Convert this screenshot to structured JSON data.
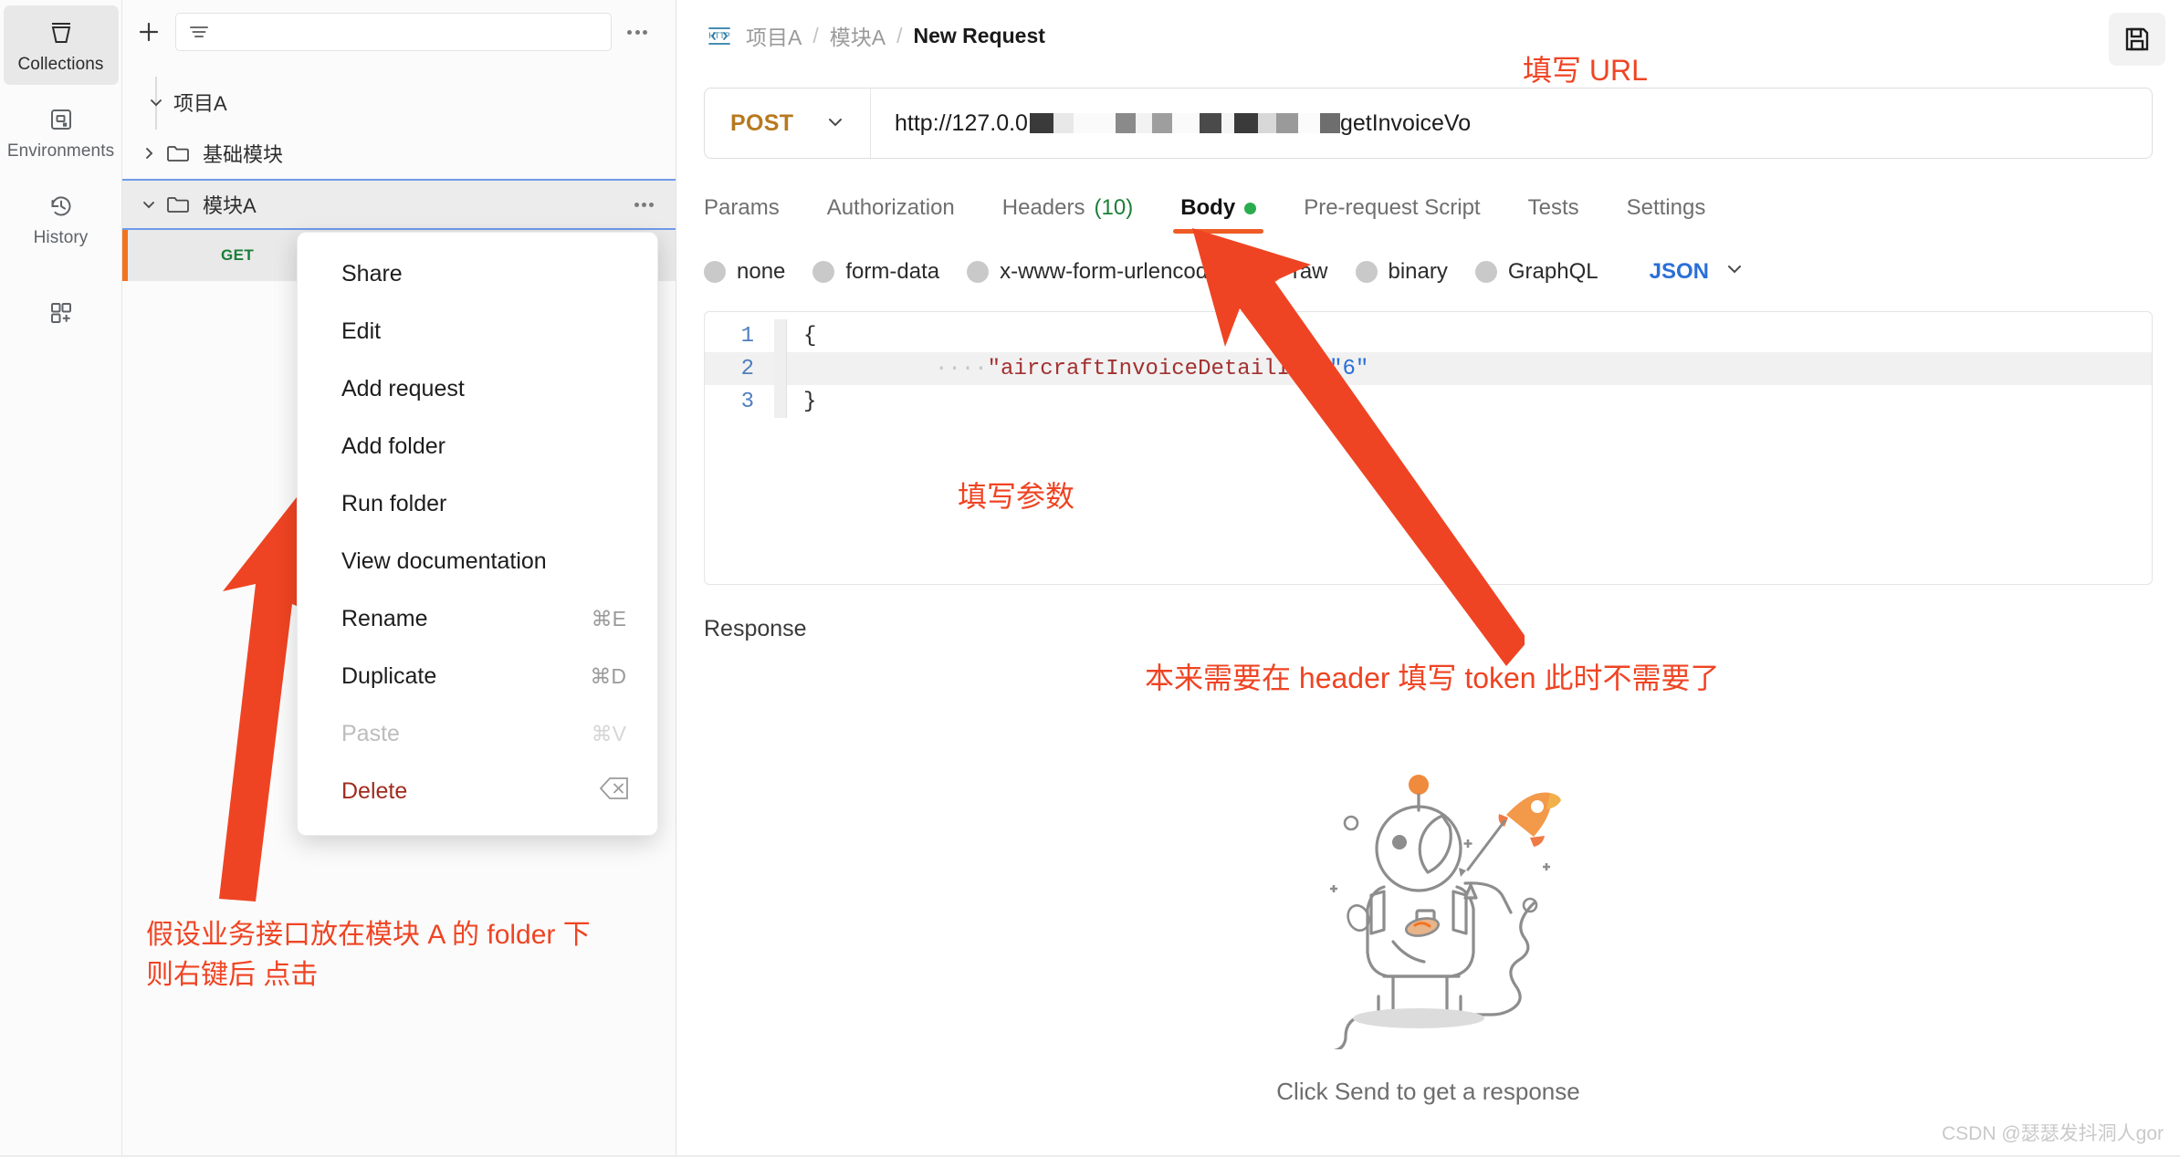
{
  "rail": {
    "items": [
      {
        "label": "Collections",
        "icon": "collections-icon",
        "active": true
      },
      {
        "label": "Environments",
        "icon": "environments-icon",
        "active": false
      },
      {
        "label": "History",
        "icon": "history-icon",
        "active": false
      },
      {
        "label": "",
        "icon": "apps-grid-icon",
        "active": false
      }
    ]
  },
  "sidebar": {
    "new_button": "+",
    "filter_placeholder": "",
    "more_options": "•••",
    "tree": [
      {
        "label": "项目A",
        "level": 1,
        "expanded": true,
        "type": "collection"
      },
      {
        "label": "基础模块",
        "level": 2,
        "expanded": false,
        "type": "folder"
      },
      {
        "label": "模块A",
        "level": 2,
        "expanded": true,
        "type": "folder",
        "selected": true
      },
      {
        "label": "",
        "level": 3,
        "method": "GET",
        "type": "request"
      }
    ]
  },
  "context_menu": {
    "items": [
      {
        "label": "Share",
        "shortcut": "",
        "disabled": false,
        "danger": false
      },
      {
        "label": "Edit",
        "shortcut": "",
        "disabled": false,
        "danger": false
      },
      {
        "label": "Add request",
        "shortcut": "",
        "disabled": false,
        "danger": false
      },
      {
        "label": "Add folder",
        "shortcut": "",
        "disabled": false,
        "danger": false
      },
      {
        "label": "Run folder",
        "shortcut": "",
        "disabled": false,
        "danger": false
      },
      {
        "label": "View documentation",
        "shortcut": "",
        "disabled": false,
        "danger": false
      },
      {
        "label": "Rename",
        "shortcut": "⌘E",
        "disabled": false,
        "danger": false
      },
      {
        "label": "Duplicate",
        "shortcut": "⌘D",
        "disabled": false,
        "danger": false
      },
      {
        "label": "Paste",
        "shortcut": "⌘V",
        "disabled": true,
        "danger": false
      },
      {
        "label": "Delete",
        "shortcut": "⌫",
        "disabled": false,
        "danger": true
      }
    ]
  },
  "request": {
    "breadcrumb": {
      "protocol_icon": "HTTP",
      "parts": [
        "项目A",
        "模块A"
      ],
      "separator": "/",
      "current": "New Request"
    },
    "method": "POST",
    "url_prefix": "http://127.0.0",
    "url_suffix": "getInvoiceVo",
    "tabs": [
      {
        "label": "Params",
        "active": false
      },
      {
        "label": "Authorization",
        "active": false
      },
      {
        "label": "Headers",
        "active": false,
        "count": "(10)"
      },
      {
        "label": "Body",
        "active": true,
        "dot": true
      },
      {
        "label": "Pre-request Script",
        "active": false
      },
      {
        "label": "Tests",
        "active": false
      },
      {
        "label": "Settings",
        "active": false
      }
    ],
    "body_types": [
      {
        "label": "none",
        "selected": false
      },
      {
        "label": "form-data",
        "selected": false
      },
      {
        "label": "x-www-form-urlencoded",
        "selected": false
      },
      {
        "label": "raw",
        "selected": true
      },
      {
        "label": "binary",
        "selected": false
      },
      {
        "label": "GraphQL",
        "selected": false
      }
    ],
    "format_select": "JSON",
    "editor": {
      "lines": [
        {
          "no": "1",
          "brace": "{",
          "indent": "",
          "key": "",
          "punct": "",
          "value": ""
        },
        {
          "no": "2",
          "brace": "",
          "indent": "····",
          "key": "\"aircraftInvoiceDetailId\"",
          "punct": ":",
          "value": "\"6\""
        },
        {
          "no": "3",
          "brace": "}",
          "indent": "",
          "key": "",
          "punct": "",
          "value": ""
        }
      ]
    }
  },
  "response": {
    "label": "Response",
    "empty_text": "Click Send to get a response"
  },
  "annotations": {
    "url_note": "填写 URL",
    "params_note": "填写参数",
    "header_note": "本来需要在 header 填写 token 此时不需要了",
    "folder_note": "假设业务接口放在模块 A 的 folder 下\n则右键后 点击"
  },
  "watermark": "CSDN @瑟瑟发抖洞人gor",
  "colors": {
    "accent_orange": "#ef5b25",
    "annotation_red": "#ef4423",
    "method_post": "#b7791f",
    "method_get": "#1a7f37",
    "selection_blue": "#6f9aea",
    "json_blue": "#2a6fd6",
    "delete_red": "#a02c1e"
  }
}
